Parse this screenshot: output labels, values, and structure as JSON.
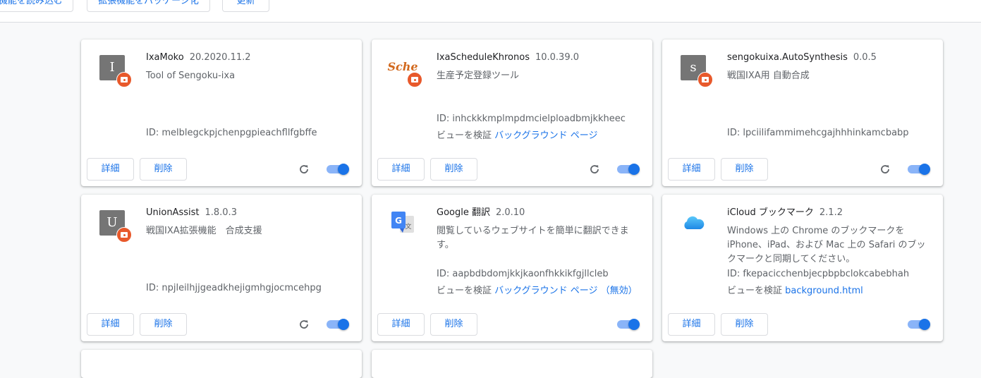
{
  "toolbar": {
    "load_unpacked": "機能を読み込む",
    "pack_extension": "拡張機能をパッケージ化",
    "update": "更新"
  },
  "buttons": {
    "details": "詳細",
    "remove": "削除"
  },
  "extensions": [
    {
      "name": "IxaMoko",
      "version": "20.2020.11.2",
      "description": "Tool of Sengoku-ixa",
      "id": "ID: melblegckpjchenpgpieachfllfgbffe",
      "icon_letter": "I",
      "enabled": true
    },
    {
      "name": "IxaScheduleKhronos",
      "version": "10.0.39.0",
      "description": "生産予定登録ツール",
      "id": "ID: inhckkkmplmpdmcielploadbmjkkheec",
      "inspect_label": "ビューを検証",
      "inspect_link": "バックグラウンド ページ",
      "icon_text": "Sche",
      "enabled": true
    },
    {
      "name": "sengokuixa.AutoSynthesis",
      "version": "0.0.5",
      "description": "戦国IXA用 自動合成",
      "id": "ID: lpciilifammimehcgajhhhinkamcbabp",
      "icon_letter": "s",
      "enabled": true
    },
    {
      "name": "UnionAssist",
      "version": "1.8.0.3",
      "description": "戦国IXA拡張機能　合成支援",
      "id": "ID: npjleilhjjgeadkhejigmhgjocmcehpg",
      "icon_letter": "U",
      "enabled": true
    },
    {
      "name": "Google 翻訳",
      "version": "2.0.10",
      "description": "閲覧しているウェブサイトを簡単に翻訳できます。",
      "id": "ID: aapbdbdomjkkjkaonfhkkikfgjllcleb",
      "inspect_label": "ビューを検証",
      "inspect_link": "バックグラウンド ページ （無効）",
      "enabled": true
    },
    {
      "name": "iCloud ブックマーク",
      "version": "2.1.2",
      "description": "Windows 上の Chrome のブックマークを iPhone、iPad、および Mac 上の Safari のブックマークと同期してください。",
      "id": "ID: fkepacicchenbjecpbpbclokcabebhah",
      "inspect_label": "ビューを検証",
      "inspect_link": "background.html",
      "enabled": true
    }
  ],
  "colors": {
    "accent": "#1a73e8",
    "badge": "#e8592b",
    "toggle_track": "#8ab4f8"
  }
}
